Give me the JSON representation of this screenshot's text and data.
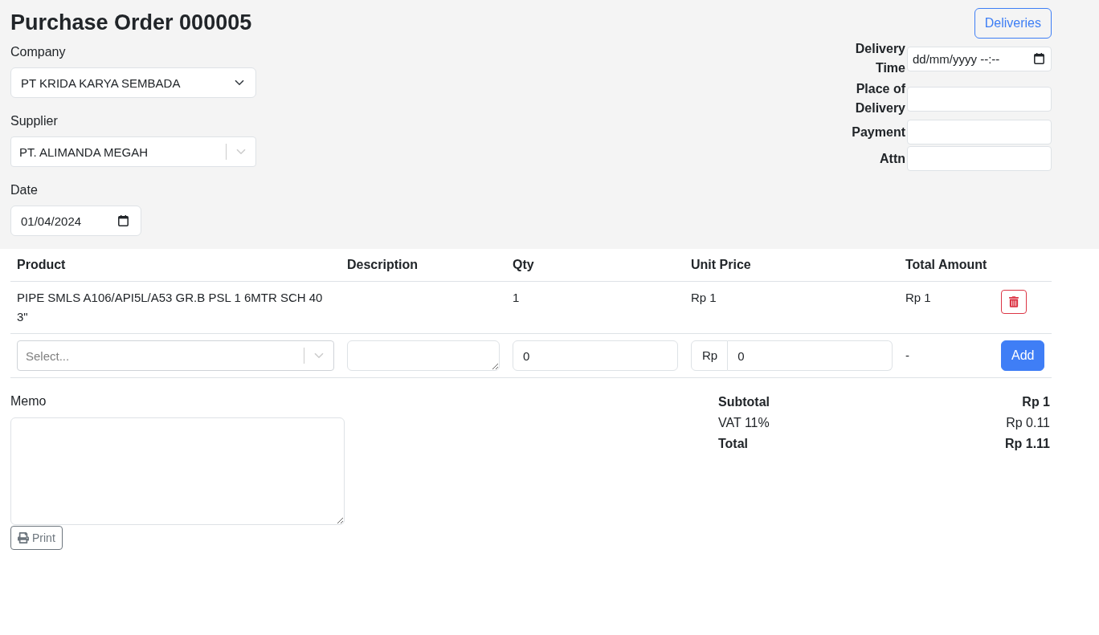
{
  "page": {
    "title": "Purchase Order 000005"
  },
  "order_fields": [
    {
      "kind": "select",
      "label": "Company",
      "value": "PT KRIDA KARYA SEMBADA"
    },
    {
      "kind": "searchable_select",
      "label": "Supplier",
      "value": "PT. ALIMANDA MEGAH"
    },
    {
      "kind": "date",
      "label": "Date",
      "value": "01/04/2024"
    }
  ],
  "deliveries_button": {
    "label": "Deliveries"
  },
  "delivery_fields": [
    {
      "kind": "datetime",
      "label": "Delivery Time",
      "placeholder": "dd/mm/yyyy --:--"
    },
    {
      "kind": "text",
      "label": "Place of Delivery"
    },
    {
      "kind": "text",
      "label": "Payment"
    },
    {
      "kind": "text",
      "label": "Attn"
    }
  ],
  "table": {
    "columns": [
      "Product",
      "Description",
      "Qty",
      "Unit Price",
      "Total Amount"
    ],
    "rows": [
      {
        "product": "PIPE SMLS A106/API5L/A53 GR.B PSL 1 6MTR SCH 40 3\"",
        "qty": "1",
        "unit_price": "Rp 1",
        "total_amount": "Rp 1"
      }
    ],
    "new_row": {
      "product_placeholder": "Select...",
      "qty": "0",
      "currency": "Rp",
      "unit_price": "0",
      "total_amount": "-",
      "add_button": "Add"
    }
  },
  "memo": {
    "label": "Memo"
  },
  "print_button": {
    "label": "Print"
  },
  "totals": [
    {
      "label": "Subtotal",
      "value": "Rp 1",
      "bold": true
    },
    {
      "label": "VAT 11%",
      "value": "Rp 0.11",
      "bold": false
    },
    {
      "label": "Total",
      "value": "Rp 1.11",
      "bold": true
    }
  ]
}
